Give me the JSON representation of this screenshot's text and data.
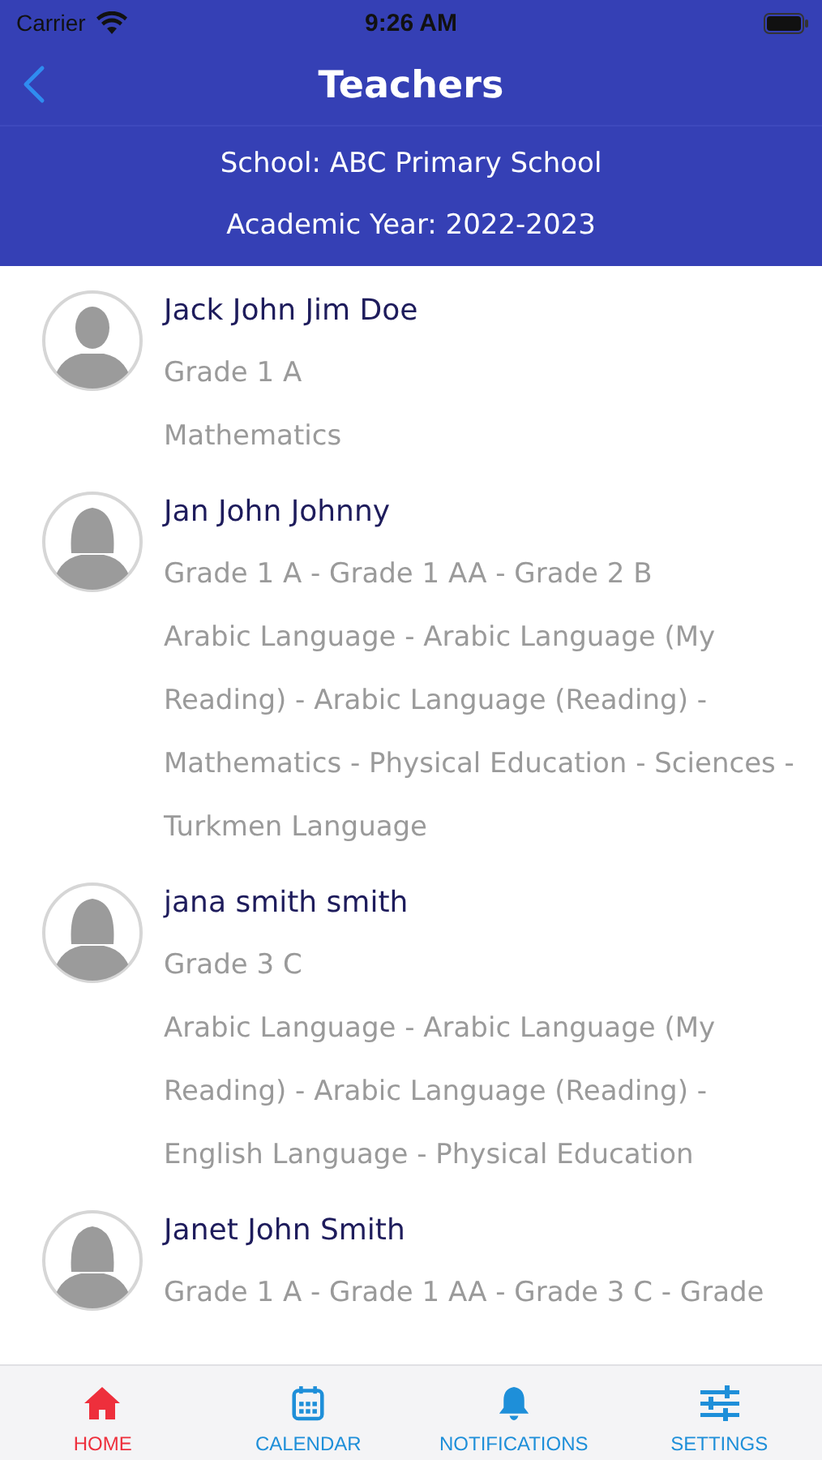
{
  "status_bar": {
    "carrier": "Carrier",
    "time": "9:26 AM"
  },
  "nav": {
    "title": "Teachers"
  },
  "info": {
    "school": "School: ABC Primary School",
    "academic_year": "Academic Year: 2022-2023"
  },
  "teachers": [
    {
      "kind": "male",
      "name": "Jack John Jim Doe",
      "grades": "Grade 1 A",
      "subjects": "Mathematics"
    },
    {
      "kind": "female",
      "name": "Jan John Johnny",
      "grades": "Grade 1 A - Grade 1 AA - Grade 2 B",
      "subjects": "Arabic Language - Arabic Language (My Reading) - Arabic Language (Reading) - Mathematics - Physical Education - Sciences - Turkmen Language"
    },
    {
      "kind": "female",
      "name": "jana smith smith",
      "grades": "Grade 3 C",
      "subjects": "Arabic Language - Arabic Language (My Reading) - Arabic Language (Reading) - English Language - Physical Education"
    },
    {
      "kind": "female",
      "name": "Janet John Smith",
      "grades": "Grade 1 A - Grade 1 AA - Grade 3 C - Grade"
    }
  ],
  "tabs": [
    {
      "kind": "home",
      "label": "HOME",
      "selected": true
    },
    {
      "kind": "calendar",
      "label": "CALENDAR",
      "selected": false
    },
    {
      "kind": "bell",
      "label": "NOTIFICATIONS",
      "selected": false
    },
    {
      "kind": "sliders",
      "label": "SETTINGS",
      "selected": false
    }
  ]
}
